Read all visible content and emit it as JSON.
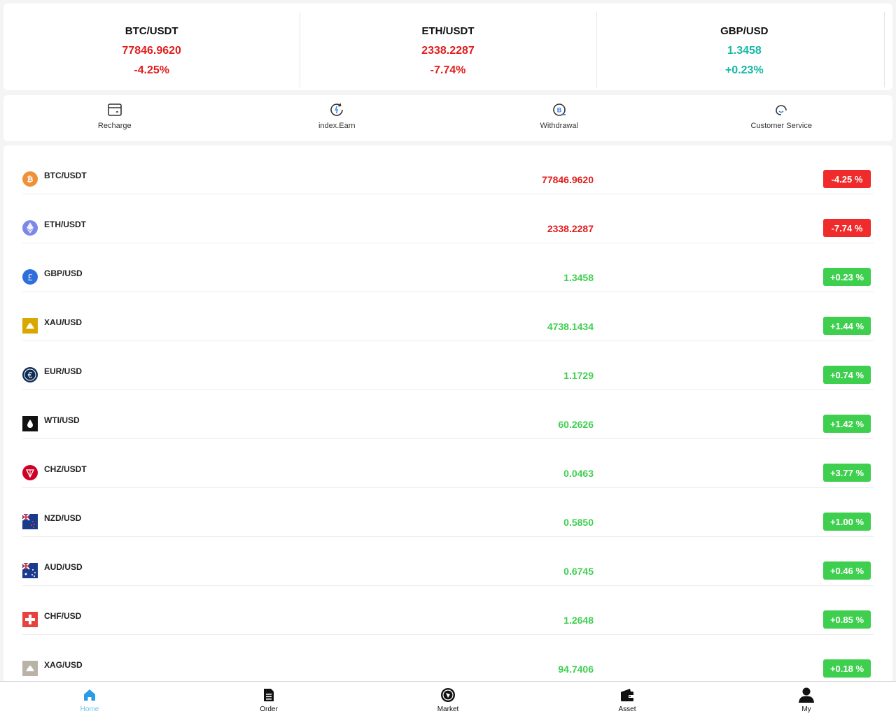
{
  "ticker": [
    {
      "symbol": "BTC/USDT",
      "price": "77846.9620",
      "change": "-4.25%",
      "trend": "down"
    },
    {
      "symbol": "ETH/USDT",
      "price": "2338.2287",
      "change": "-7.74%",
      "trend": "down"
    },
    {
      "symbol": "GBP/USD",
      "price": "1.3458",
      "change": "+0.23%",
      "trend": "up"
    }
  ],
  "actions": [
    {
      "label": "Recharge",
      "icon": "wallet-card-icon"
    },
    {
      "label": "index.Earn",
      "icon": "earn-refresh-icon"
    },
    {
      "label": "Withdrawal",
      "icon": "bitcoin-withdraw-icon"
    },
    {
      "label": "Customer Service",
      "icon": "headset-icon"
    }
  ],
  "market": [
    {
      "symbol": "BTC/USDT",
      "price": "77846.9620",
      "change": "-4.25 %",
      "trend": "down",
      "icon": "bitcoin-icon"
    },
    {
      "symbol": "ETH/USDT",
      "price": "2338.2287",
      "change": "-7.74 %",
      "trend": "down",
      "icon": "ethereum-icon"
    },
    {
      "symbol": "GBP/USD",
      "price": "1.3458",
      "change": "+0.23 %",
      "trend": "up",
      "icon": "pound-icon"
    },
    {
      "symbol": "XAU/USD",
      "price": "4738.1434",
      "change": "+1.44 %",
      "trend": "up",
      "icon": "gold-bar-icon"
    },
    {
      "symbol": "EUR/USD",
      "price": "1.1729",
      "change": "+0.74 %",
      "trend": "up",
      "icon": "euro-icon"
    },
    {
      "symbol": "WTI/USD",
      "price": "60.2626",
      "change": "+1.42 %",
      "trend": "up",
      "icon": "oil-drop-icon"
    },
    {
      "symbol": "CHZ/USDT",
      "price": "0.0463",
      "change": "+3.77 %",
      "trend": "up",
      "icon": "chiliz-icon"
    },
    {
      "symbol": "NZD/USD",
      "price": "0.5850",
      "change": "+1.00 %",
      "trend": "up",
      "icon": "nz-flag-icon"
    },
    {
      "symbol": "AUD/USD",
      "price": "0.6745",
      "change": "+0.46 %",
      "trend": "up",
      "icon": "au-flag-icon"
    },
    {
      "symbol": "CHF/USD",
      "price": "1.2648",
      "change": "+0.85 %",
      "trend": "up",
      "icon": "swiss-flag-icon"
    },
    {
      "symbol": "XAG/USD",
      "price": "94.7406",
      "change": "+0.18 %",
      "trend": "up",
      "icon": "silver-bar-icon"
    }
  ],
  "nav": [
    {
      "label": "Home",
      "icon": "home-icon",
      "active": true
    },
    {
      "label": "Order",
      "icon": "document-icon",
      "active": false
    },
    {
      "label": "Market",
      "icon": "market-icon",
      "active": false
    },
    {
      "label": "Asset",
      "icon": "wallet-icon",
      "active": false
    },
    {
      "label": "My",
      "icon": "user-icon",
      "active": false
    }
  ],
  "colors": {
    "down": "#e11d1d",
    "up": "#3fcf4f",
    "ticker_up": "#14b8a6",
    "nav_active": "#6cc3ef"
  }
}
